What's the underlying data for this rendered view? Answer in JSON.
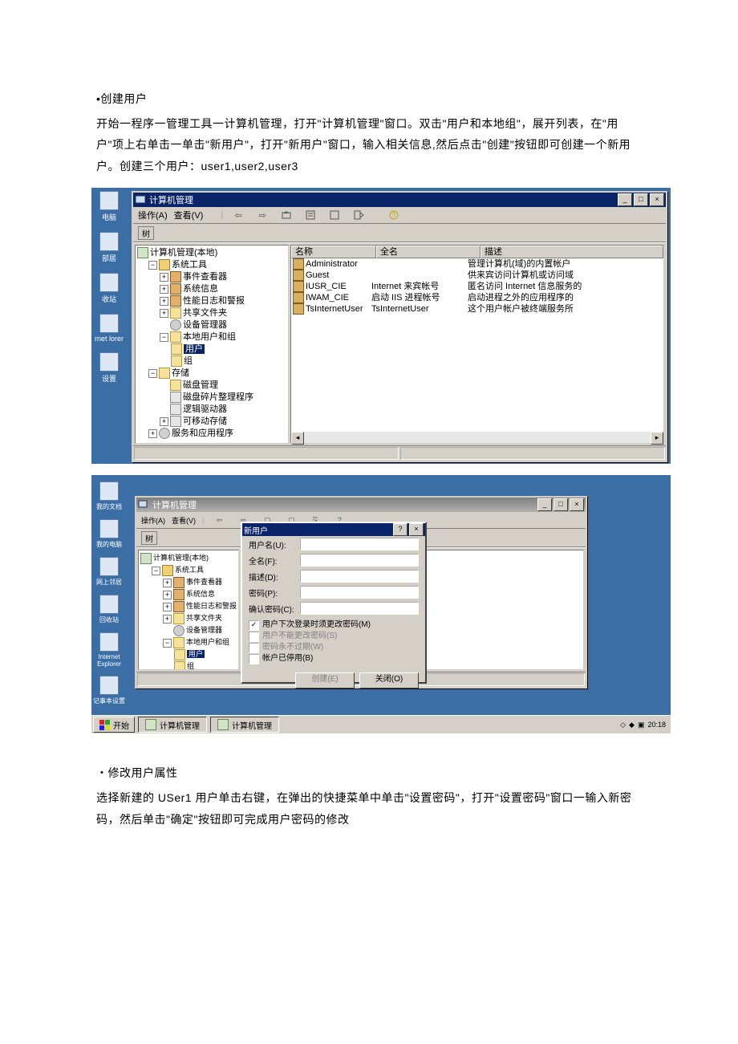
{
  "text": {
    "h1": "•创建用户",
    "p1": "开始一程序一管理工具一计算机管理，打开\"计算机管理\"窗口。双击\"用户和本地组\"，展开列表，在\"用户\"项上右单击一单击\"新用户\"，打开\"新用户\"窗口，输入相关信息,然后点击\"创建\"按钮即可创建一个新用户。创建三个用户：user1,user2,user3",
    "h2": "・修改用户属性",
    "p2": "选择新建的 USer1 用户单击右键，在弹出的快捷菜单中单击\"设置密码\"，打开\"设置密码\"窗口一输入新密码，然后单击\"确定\"按钮即可完成用户密码的修改"
  },
  "desktop1": {
    "icons": [
      "电脑",
      "部居",
      "收站",
      "rnet lorer",
      "设置"
    ]
  },
  "desktop2": {
    "icons": [
      "我的文档",
      "我的电脑",
      "网上邻居",
      "回收站",
      "Internet Explorer",
      "记事本设置"
    ],
    "taskbar": {
      "start": "开始",
      "items": [
        "计算机管理",
        "计算机管理"
      ],
      "clock": "20:18"
    }
  },
  "win1": {
    "title": "计算机管理",
    "menu": {
      "action": "操作(A)",
      "view": "查看(V)"
    },
    "tree": {
      "label": "树",
      "root": "计算机管理(本地)",
      "systools": "系统工具",
      "st_items": [
        "事件查看器",
        "系统信息",
        "性能日志和警报",
        "共享文件夹",
        "设备管理器",
        "本地用户和组"
      ],
      "users_group": [
        "用户",
        "组"
      ],
      "storage": "存储",
      "storage_items": [
        "磁盘管理",
        "磁盘碎片整理程序",
        "逻辑驱动器",
        "可移动存储"
      ],
      "services": "服务和应用程序"
    },
    "cols": {
      "name": "名称",
      "fullname": "全名",
      "desc": "描述"
    },
    "rows": [
      {
        "n": "Administrator",
        "f": "",
        "d": "管理计算机(域)的内置帐户"
      },
      {
        "n": "Guest",
        "f": "",
        "d": "供来宾访问计算机或访问域"
      },
      {
        "n": "IUSR_CIE",
        "f": "Internet 来宾帐号",
        "d": "匿名访问 Internet 信息服务的"
      },
      {
        "n": "IWAM_CIE",
        "f": "启动 IIS 进程帐号",
        "d": "启动进程之外的应用程序的"
      },
      {
        "n": "TsInternetUser",
        "f": "TsInternetUser",
        "d": "这个用户帐户被终端服务所"
      }
    ]
  },
  "win2": {
    "title": "计算机管理",
    "dialog": {
      "title": "新用户",
      "username": "用户名(U):",
      "fullname": "全名(F):",
      "desc": "描述(D):",
      "password": "密码(P):",
      "confirm": "确认密码(C):",
      "opts": [
        "用户下次登录时须更改密码(M)",
        "用户不能更改密码(S)",
        "密码永不过期(W)",
        "帐户已停用(B)"
      ],
      "create": "创建(E)",
      "close": "关闭(O)"
    }
  }
}
